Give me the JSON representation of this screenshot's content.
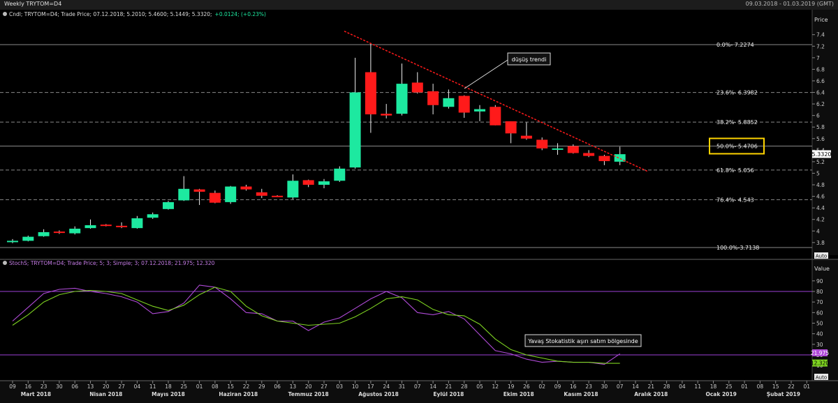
{
  "window": {
    "title": "Weekly TRYTOM=D4",
    "date_range": "09.03.2018 - 01.03.2019 (GMT)"
  },
  "colors": {
    "up": "#1de9a0",
    "down": "#ff1a1a",
    "stoch_k": "#b04bd8",
    "stoch_d": "#7ed321",
    "fib": "#8a8a8a",
    "trend": "#ff1a1a",
    "highlight": "#ffd400"
  },
  "price_panel": {
    "legend_prefix": "Cndl; TRYTOM=D4; Trade Price; 07.12.2018; 5.2010; 5.4600; 5.1449; 5.3320;",
    "legend_change": "+0.0124; (+0.23%)",
    "axis_title": "Price",
    "last_price": "5.3320",
    "auto_label": "Auto",
    "annotation": "düşüş trendi"
  },
  "stoch_panel": {
    "legend_text": "StochS; TRYTOM=D4; Trade Price;  5; 3; Simple; 3; 07.12.2018; 21.975; 12.320",
    "axis_title": "Value",
    "k_value": "21.975",
    "d_value": "12.320",
    "auto_label": "Auto",
    "annotation": "Yavaş Stokatistik aşırı satım bölgesinde"
  },
  "x_axis": {
    "dates": [
      "09",
      "16",
      "23",
      "30",
      "06",
      "13",
      "20",
      "27",
      "04",
      "11",
      "18",
      "25",
      "01",
      "08",
      "15",
      "22",
      "29",
      "06",
      "13",
      "20",
      "27",
      "03",
      "10",
      "17",
      "24",
      "31",
      "07",
      "14",
      "21",
      "28",
      "05",
      "12",
      "19",
      "26",
      "02",
      "09",
      "16",
      "23",
      "30",
      "07",
      "14",
      "21",
      "28",
      "04",
      "11",
      "18",
      "25",
      "01",
      "08",
      "15",
      "22",
      "01"
    ],
    "months": [
      {
        "label": "Mart 2018",
        "index": 1.5
      },
      {
        "label": "Nisan 2018",
        "index": 6.0
      },
      {
        "label": "Mayıs 2018",
        "index": 10.0
      },
      {
        "label": "Haziran 2018",
        "index": 14.5
      },
      {
        "label": "Temmuz 2018",
        "index": 19.0
      },
      {
        "label": "Ağustos 2018",
        "index": 23.5
      },
      {
        "label": "Eylül 2018",
        "index": 28.0
      },
      {
        "label": "Ekim 2018",
        "index": 32.5
      },
      {
        "label": "Kasım 2018",
        "index": 36.5
      },
      {
        "label": "Aralık 2018",
        "index": 41.0
      },
      {
        "label": "Ocak 2019",
        "index": 45.5
      },
      {
        "label": "Şubat 2019",
        "index": 49.5
      }
    ]
  },
  "chart_data": [
    {
      "type": "candlestick",
      "ylim": [
        3.6,
        7.6
      ],
      "yticks": [
        3.8,
        4.0,
        4.2,
        4.4,
        4.6,
        4.8,
        5.0,
        5.2,
        5.4,
        5.6,
        5.8,
        6.0,
        6.2,
        6.4,
        6.6,
        6.8,
        7.0,
        7.2,
        7.4
      ],
      "ytick_labels": [
        "3.8",
        "4",
        "4.2",
        "4.4",
        "4.6",
        "4.8",
        "5",
        "5.2",
        "5.4",
        "5.6",
        "5.8",
        "6",
        "6.2",
        "6.4",
        "6.6",
        "6.8",
        "7",
        "7.2",
        "7.4"
      ],
      "candles": [
        {
          "o": 3.81,
          "h": 3.86,
          "l": 3.79,
          "c": 3.83
        },
        {
          "o": 3.83,
          "h": 3.92,
          "l": 3.82,
          "c": 3.9
        },
        {
          "o": 3.91,
          "h": 4.03,
          "l": 3.9,
          "c": 3.98
        },
        {
          "o": 3.99,
          "h": 4.01,
          "l": 3.95,
          "c": 3.97
        },
        {
          "o": 3.96,
          "h": 4.08,
          "l": 3.94,
          "c": 4.04
        },
        {
          "o": 4.05,
          "h": 4.2,
          "l": 4.04,
          "c": 4.1
        },
        {
          "o": 4.11,
          "h": 4.12,
          "l": 4.08,
          "c": 4.09
        },
        {
          "o": 4.09,
          "h": 4.15,
          "l": 4.05,
          "c": 4.07
        },
        {
          "o": 4.05,
          "h": 4.26,
          "l": 4.04,
          "c": 4.22
        },
        {
          "o": 4.23,
          "h": 4.32,
          "l": 4.21,
          "c": 4.29
        },
        {
          "o": 4.38,
          "h": 4.52,
          "l": 4.37,
          "c": 4.5
        },
        {
          "o": 4.53,
          "h": 4.95,
          "l": 4.52,
          "c": 4.73
        },
        {
          "o": 4.72,
          "h": 4.73,
          "l": 4.45,
          "c": 4.68
        },
        {
          "o": 4.66,
          "h": 4.7,
          "l": 4.48,
          "c": 4.49
        },
        {
          "o": 4.5,
          "h": 4.78,
          "l": 4.47,
          "c": 4.77
        },
        {
          "o": 4.77,
          "h": 4.8,
          "l": 4.7,
          "c": 4.72
        },
        {
          "o": 4.67,
          "h": 4.73,
          "l": 4.57,
          "c": 4.61
        },
        {
          "o": 4.61,
          "h": 4.62,
          "l": 4.59,
          "c": 4.6
        },
        {
          "o": 4.58,
          "h": 4.98,
          "l": 4.55,
          "c": 4.87
        },
        {
          "o": 4.88,
          "h": 4.89,
          "l": 4.76,
          "c": 4.8
        },
        {
          "o": 4.8,
          "h": 4.9,
          "l": 4.74,
          "c": 4.86
        },
        {
          "o": 4.87,
          "h": 5.12,
          "l": 4.85,
          "c": 5.08
        },
        {
          "o": 5.1,
          "h": 7.0,
          "l": 5.08,
          "c": 6.4
        },
        {
          "o": 6.75,
          "h": 7.25,
          "l": 5.7,
          "c": 6.02
        },
        {
          "o": 6.03,
          "h": 6.2,
          "l": 5.95,
          "c": 6.0
        },
        {
          "o": 6.03,
          "h": 6.9,
          "l": 6.0,
          "c": 6.55
        },
        {
          "o": 6.57,
          "h": 6.75,
          "l": 6.38,
          "c": 6.4
        },
        {
          "o": 6.42,
          "h": 6.55,
          "l": 6.02,
          "c": 6.18
        },
        {
          "o": 6.15,
          "h": 6.45,
          "l": 6.12,
          "c": 6.3
        },
        {
          "o": 6.34,
          "h": 6.35,
          "l": 5.96,
          "c": 6.05
        },
        {
          "o": 6.07,
          "h": 6.18,
          "l": 5.9,
          "c": 6.11
        },
        {
          "o": 6.15,
          "h": 6.18,
          "l": 5.83,
          "c": 5.83
        },
        {
          "o": 5.9,
          "h": 5.9,
          "l": 5.52,
          "c": 5.69
        },
        {
          "o": 5.65,
          "h": 5.88,
          "l": 5.58,
          "c": 5.6
        },
        {
          "o": 5.58,
          "h": 5.62,
          "l": 5.4,
          "c": 5.43
        },
        {
          "o": 5.43,
          "h": 5.52,
          "l": 5.32,
          "c": 5.43
        },
        {
          "o": 5.47,
          "h": 5.5,
          "l": 5.34,
          "c": 5.35
        },
        {
          "o": 5.35,
          "h": 5.4,
          "l": 5.28,
          "c": 5.3
        },
        {
          "o": 5.3,
          "h": 5.32,
          "l": 5.14,
          "c": 5.21
        },
        {
          "o": 5.2,
          "h": 5.46,
          "l": 5.14,
          "c": 5.33
        }
      ],
      "fib_levels": [
        {
          "level": "0.0%",
          "value": 7.2274,
          "label": "0.0%- 7.2274"
        },
        {
          "level": "23.6%",
          "value": 6.3982,
          "label": "23.6%- 6.3982"
        },
        {
          "level": "38.2%",
          "value": 5.8852,
          "label": "38.2%- 5.8852"
        },
        {
          "level": "50.0%",
          "value": 5.4706,
          "label": "50.0%- 5.4706"
        },
        {
          "level": "61.8%",
          "value": 5.056,
          "label": "61.8%- 5.056"
        },
        {
          "level": "76.4%",
          "value": 4.543,
          "label": "76.4%- 4.543"
        },
        {
          "level": "100.0%",
          "value": 3.7138,
          "label": "100.0%-3.7138"
        }
      ],
      "trendline": {
        "start": {
          "i": 21.3,
          "v": 7.46
        },
        "end": {
          "i": 40.8,
          "v": 5.03
        }
      }
    },
    {
      "type": "line",
      "ylim": [
        5,
        100
      ],
      "yticks": [
        10,
        20,
        30,
        40,
        50,
        60,
        70,
        80,
        90
      ],
      "reference_lines": [
        80,
        20
      ],
      "series": [
        {
          "name": "StochS %K",
          "values": [
            52,
            65,
            78,
            82,
            83,
            80,
            78,
            75,
            70,
            59,
            61,
            69,
            86,
            84,
            73,
            60,
            59,
            52,
            52,
            43,
            51,
            55,
            64,
            73,
            80,
            74,
            60,
            58,
            61,
            54,
            39,
            24,
            21,
            16,
            13,
            14,
            13,
            13,
            11,
            21
          ]
        },
        {
          "name": "StochS %D",
          "values": [
            48,
            58,
            70,
            77,
            80,
            81,
            80,
            78,
            72,
            66,
            62,
            67,
            77,
            84,
            80,
            66,
            57,
            52,
            50,
            48,
            49,
            50,
            56,
            64,
            73,
            75,
            72,
            63,
            58,
            57,
            49,
            35,
            25,
            20,
            17,
            14,
            13,
            13,
            12,
            12
          ]
        }
      ]
    }
  ]
}
